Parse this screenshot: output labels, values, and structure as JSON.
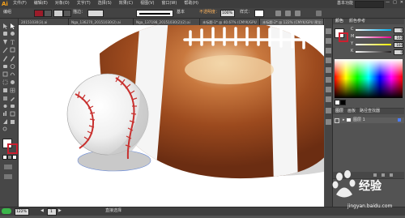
{
  "menubar": {
    "logo": "Ai",
    "menus": [
      "文件(F)",
      "编辑(E)",
      "对象(O)",
      "文字(T)",
      "选择(S)",
      "效果(C)",
      "视图(V)",
      "窗口(W)",
      "帮助(H)"
    ],
    "right_label": "基本功能",
    "window_buttons": [
      "—",
      "□",
      "✕"
    ]
  },
  "controlbar": {
    "selection_label": "编组",
    "stroke_label": "描边：",
    "brush_label": "基本",
    "opacity_label": "不透明度：",
    "opacity_value": "100%",
    "style_label": "样式：",
    "fill_color": "#9b1c2a",
    "stroke_color": "#cfcfcf"
  },
  "tabs": [
    {
      "label": "20151030(3).ai",
      "active": false
    },
    {
      "label": "Nga_136270_20151030(2).ai",
      "active": false
    },
    {
      "label": "Nga_137198_20151030(2)(2).ai",
      "active": false
    },
    {
      "label": "未标题-1* @ 40.67% (CMYK/GPU 预览)",
      "active": false
    },
    {
      "label": "未标题-2* @ 122% (CMYK/GPU 预览)",
      "active": true
    }
  ],
  "color_panel": {
    "tabs": [
      "颜色",
      "颜色参考"
    ],
    "channels": [
      {
        "name": "C",
        "value": "0",
        "color": "#00aeef"
      },
      {
        "name": "M",
        "value": "100",
        "color": "#ec008c"
      },
      {
        "name": "Y",
        "value": "100",
        "color": "#fff200"
      },
      {
        "name": "K",
        "value": "0",
        "color": "#231f20"
      }
    ]
  },
  "layers_panel": {
    "tabs": [
      "图层",
      "画板",
      "路径查找器"
    ],
    "layer_name": "图层 1"
  },
  "statusbar": {
    "zoom": "122%",
    "page": "1",
    "tool_label": "直接选择"
  },
  "watermark": {
    "text": "经验",
    "url": "jingyan.baidu.com"
  }
}
